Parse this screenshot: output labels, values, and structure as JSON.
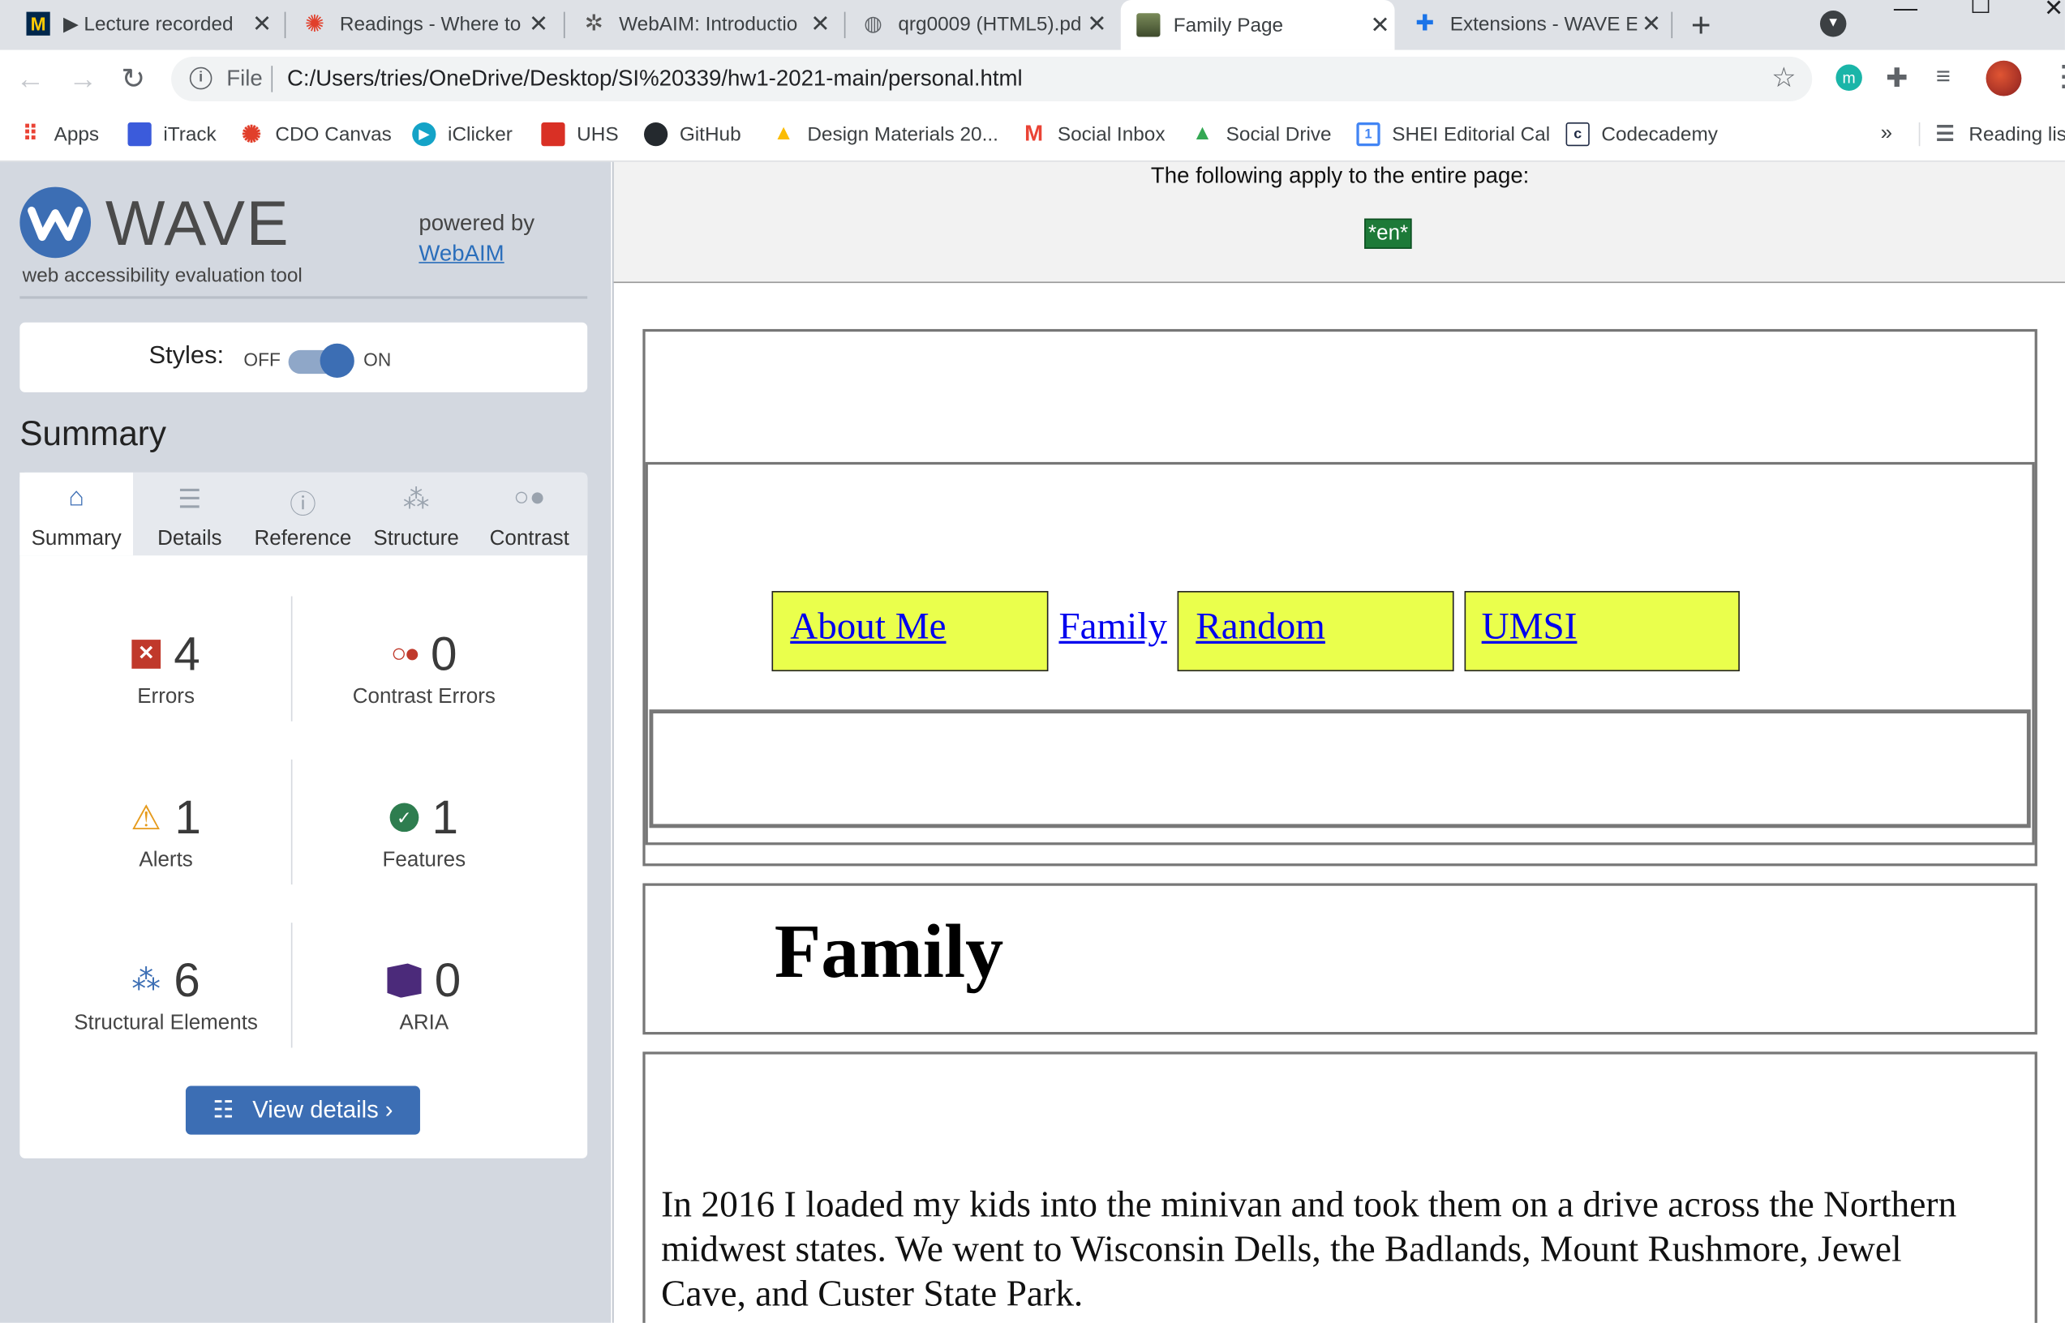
{
  "browser": {
    "tabs": [
      {
        "title": "▶ Lecture recorded",
        "active": false
      },
      {
        "title": "Readings - Where to",
        "active": false
      },
      {
        "title": "WebAIM: Introductio",
        "active": false
      },
      {
        "title": "qrg0009 (HTML5).pd",
        "active": false
      },
      {
        "title": "Family Page",
        "active": true
      },
      {
        "title": "Extensions - WAVE E",
        "active": false
      }
    ],
    "address": {
      "scheme_label": "File",
      "url": "C:/Users/tries/OneDrive/Desktop/SI%20339/hw1-2021-main/personal.html"
    },
    "bookmarks": [
      {
        "label": "Apps"
      },
      {
        "label": "iTrack"
      },
      {
        "label": "CDO Canvas"
      },
      {
        "label": "iClicker"
      },
      {
        "label": "UHS"
      },
      {
        "label": "GitHub"
      },
      {
        "label": "Design Materials 20..."
      },
      {
        "label": "Social Inbox"
      },
      {
        "label": "Social Drive"
      },
      {
        "label": "SHEI Editorial Cal"
      },
      {
        "label": "Codecademy"
      }
    ],
    "reading_list": "Reading list",
    "overflow": "»"
  },
  "wave": {
    "logo_word": "WAVE",
    "tagline": "web accessibility evaluation tool",
    "powered_by": "powered by",
    "webaim_link": "WebAIM",
    "styles_label": "Styles:",
    "styles_off": "OFF",
    "styles_on": "ON",
    "summary_heading": "Summary",
    "tabs": [
      {
        "label": "Summary",
        "icon": "home-icon"
      },
      {
        "label": "Details",
        "icon": "list-icon"
      },
      {
        "label": "Reference",
        "icon": "info-icon"
      },
      {
        "label": "Structure",
        "icon": "hierarchy-icon"
      },
      {
        "label": "Contrast",
        "icon": "contrast-icon"
      }
    ],
    "stats": {
      "errors": {
        "count": "4",
        "label": "Errors"
      },
      "contrast_errors": {
        "count": "0",
        "label": "Contrast Errors"
      },
      "alerts": {
        "count": "1",
        "label": "Alerts"
      },
      "features": {
        "count": "1",
        "label": "Features"
      },
      "structural": {
        "count": "6",
        "label": "Structural Elements"
      },
      "aria": {
        "count": "0",
        "label": "ARIA"
      }
    },
    "view_details": "View details ›",
    "colors": {
      "accent": "#3c6eb4",
      "error": "#c0392b",
      "alert": "#e69b1d",
      "feature": "#2e7d4f",
      "aria": "#4b2a7a"
    }
  },
  "page": {
    "applies_text": "The following apply to the entire page:",
    "lang_badge": "*en*",
    "nav": [
      {
        "label": "About Me"
      },
      {
        "label": "Family"
      },
      {
        "label": "Random"
      },
      {
        "label": "UMSI"
      }
    ],
    "heading": "Family",
    "paragraph": "In 2016 I loaded my kids into the minivan and took them on a drive across the Northern midwest states. We went to Wisconsin Dells, the Badlands, Mount Rushmore, Jewel Cave, and Custer State Park.",
    "colors": {
      "nav_bg": "#eaff4c",
      "link": "#0000ee",
      "lang_badge": "#1d7a38"
    }
  }
}
